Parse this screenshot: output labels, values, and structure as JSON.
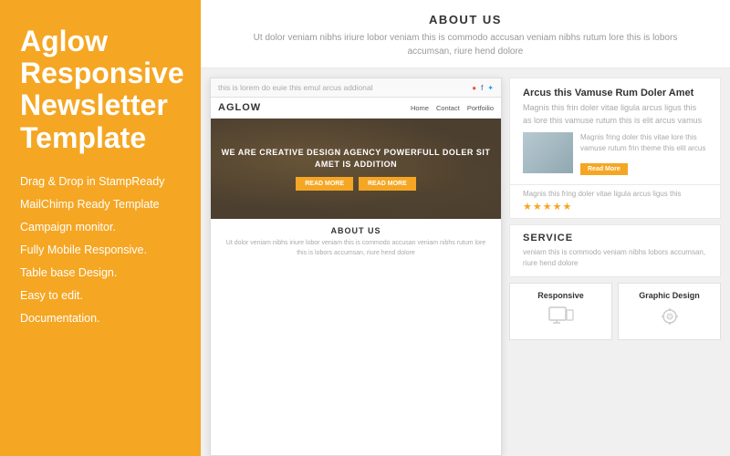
{
  "left": {
    "title": "Aglow Responsive Newsletter Template",
    "features": [
      "Drag & Drop in StampReady",
      "MailChimp Ready Template",
      "Campaign monitor.",
      "Fully Mobile Responsive.",
      "Table base Design.",
      "Easy to edit.",
      "Documentation."
    ]
  },
  "top_about": {
    "heading": "ABOUT US",
    "text": "Ut dolor veniam nibhs iriure lobor veniam this is commodo accusan veniam nibhs rutum lore this is lobors accumsan, riure hend dolore"
  },
  "newsletter": {
    "email_subject": "this is lorem do euie this emul arcus addional",
    "nav": {
      "logo": "AGLOW",
      "links": [
        "Home",
        "Contact",
        "Portfoilio"
      ]
    },
    "hero": {
      "text": "WE ARE CREATIVE DESIGN AGENCY POWERFULL DOLER SIT AMET IS ADDITION",
      "btn1": "Read More",
      "btn2": "Read More"
    },
    "about_preview": {
      "heading": "ABOUT US",
      "text": "Ut dolor veniam nibhs iriure lobor veniam this is commodo accusan veniam nibhs rutum lore this is lobors accumsan, riure hend dolore"
    }
  },
  "right_col": {
    "article": {
      "heading": "Arcus this Vamuse Rum Doler Amet",
      "intro": "Magnis this frin doler vitae ligula arcus ligus this as lore this vamuse rutum this is elit arcus vamus",
      "detail": "Magnis fring doler this vitae lore this vamuse rutum frin theme this elit arcus",
      "read_more": "Read More"
    },
    "review": {
      "text": "Magnis this fring doler vitae ligula arcus ligus this",
      "stars": "★★★★★"
    },
    "service": {
      "heading": "SERVICE",
      "text": "veniam this is commodo veniam nibhs lobors accumsan, riure hend dolore"
    },
    "cards": [
      {
        "title": "Responsive",
        "icon": "responsive"
      },
      {
        "title": "Graphic Design",
        "icon": "graphic"
      }
    ]
  }
}
